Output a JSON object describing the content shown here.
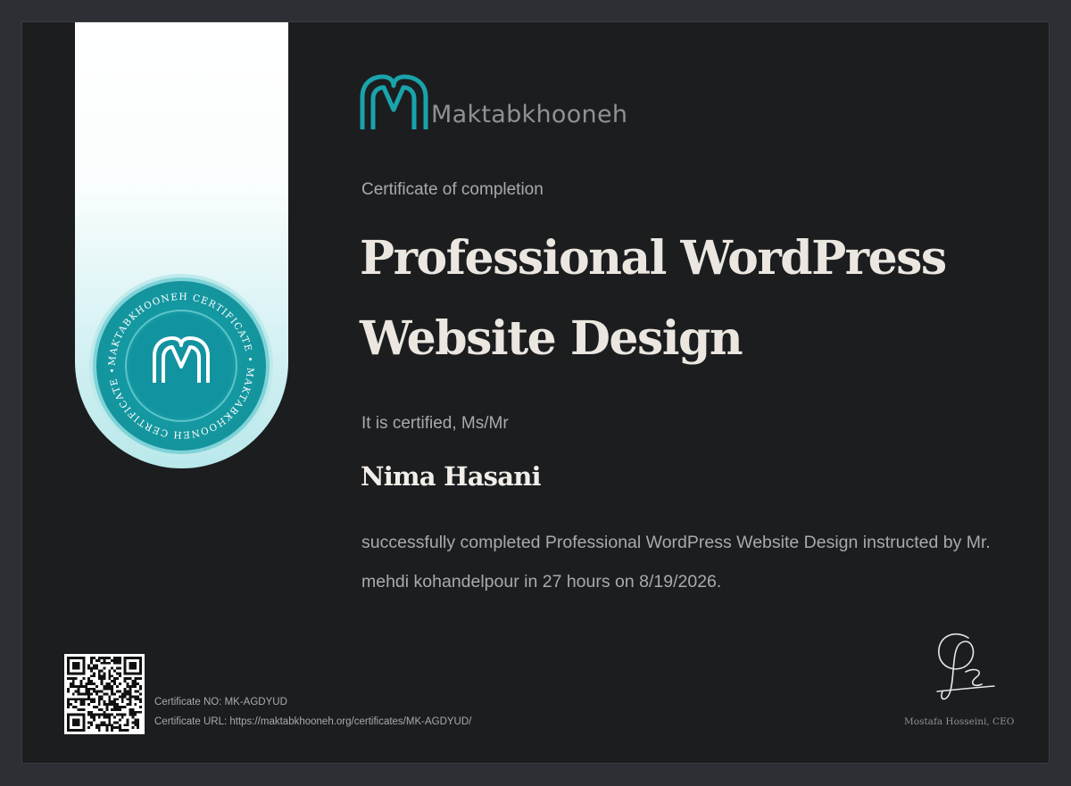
{
  "certificate": {
    "brand_name": "Maktabkhooneh",
    "seal_text": "MAKTABKHOONEH CERTIFICATE • MAKTABKHOONEH CERTIFICATE •",
    "subtitle": "Certificate of completion",
    "course_title": "Professional WordPress Website Design",
    "certified_label": "It is certified, Ms/Mr",
    "recipient_name": "Nima Hasani",
    "description": "successfully completed Professional WordPress Website Design instructed by Mr. mehdi kohandelpour in 27 hours on 8/19/2026.",
    "certificate_no": "Certificate NO: MK-AGDYUD",
    "certificate_url": "Certificate URL: https://maktabkhooneh.org/certificates/MK-AGDYUD/",
    "signer": "Mostafa Hosseini, CEO"
  },
  "colors": {
    "background": "#2d2f34",
    "paper": "#1c1d1f",
    "teal": "#17a3aa",
    "title_text": "#ebe7e0",
    "body_text": "#a8aaad"
  },
  "icons": {
    "brand_logo": "maktabkhooneh-logo-icon",
    "seal_logo": "maktabkhooneh-seal-icon",
    "qr": "qr-code",
    "signature": "handwritten-signature"
  }
}
